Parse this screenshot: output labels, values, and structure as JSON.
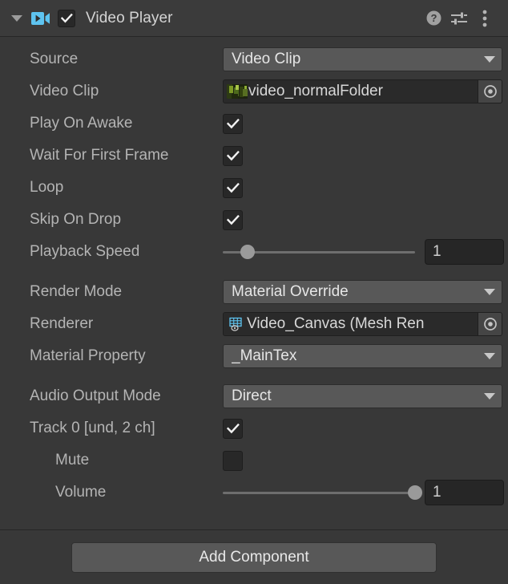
{
  "header": {
    "foldout_icon": "triangle-down-icon",
    "component_icon": "video-player-icon",
    "enabled": true,
    "title": "Video Player",
    "help_icon": "help-icon",
    "preset_icon": "preset-settings-icon",
    "menu_icon": "more-vertical-icon"
  },
  "colors": {
    "panel_bg": "#383838",
    "header_bg": "#3b3b3b",
    "popup_bg": "#585858",
    "object_field_bg": "#2a2a2a",
    "label_text": "#b4b4b4",
    "value_text": "#e6e6e6",
    "accent_icon": "#5ec4f0"
  },
  "properties": {
    "source": {
      "label": "Source",
      "value": "Video Clip",
      "type": "popup"
    },
    "video_clip": {
      "label": "Video Clip",
      "value": "video_normalFolder",
      "type": "object",
      "thumbnail": "video-thumbnail",
      "picker_icon": "object-picker-icon"
    },
    "play_on_awake": {
      "label": "Play On Awake",
      "value": true,
      "type": "toggle"
    },
    "wait_for_first_frame": {
      "label": "Wait For First Frame",
      "value": true,
      "type": "toggle"
    },
    "loop": {
      "label": "Loop",
      "value": true,
      "type": "toggle"
    },
    "skip_on_drop": {
      "label": "Skip On Drop",
      "value": true,
      "type": "toggle"
    },
    "playback_speed": {
      "label": "Playback Speed",
      "value": "1",
      "type": "slider",
      "knob_percent": 13
    },
    "render_mode": {
      "label": "Render Mode",
      "value": "Material Override",
      "type": "popup"
    },
    "renderer": {
      "label": "Renderer",
      "value": "Video_Canvas (Mesh Ren",
      "type": "object",
      "icon": "mesh-renderer-icon",
      "picker_icon": "object-picker-icon"
    },
    "material_property": {
      "label": "Material Property",
      "value": "_MainTex",
      "type": "popup"
    },
    "audio_output_mode": {
      "label": "Audio Output Mode",
      "value": "Direct",
      "type": "popup"
    },
    "track_0": {
      "label": "Track 0 [und, 2 ch]",
      "value": true,
      "type": "toggle"
    },
    "mute": {
      "label": "Mute",
      "value": false,
      "type": "toggle"
    },
    "volume": {
      "label": "Volume",
      "value": "1",
      "type": "slider",
      "knob_percent": 100
    }
  },
  "footer": {
    "add_component_label": "Add Component"
  }
}
